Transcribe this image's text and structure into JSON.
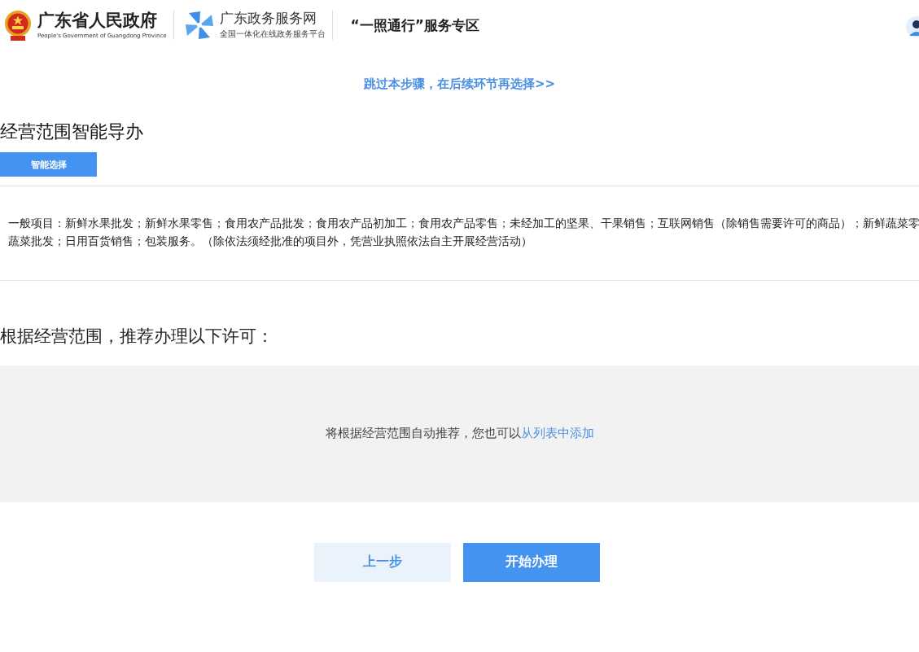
{
  "header": {
    "gov_title": "广东省人民政府",
    "gov_subtitle": "People's Government of Guangdong Province",
    "service_title": "广东政务服务网",
    "service_subtitle": "全国一体化在线政务服务平台",
    "zone_title": "“一照通行”服务专区"
  },
  "skip_link": "跳过本步骤，在后续环节再选择>>",
  "guide": {
    "title": "经营范围智能导办",
    "button": "智能选择"
  },
  "scope_lines": [
    "一般项目：新鲜水果批发；新鲜水果零售；食用农产品批发；食用农产品初加工；食用农产品零售；未经加工的坚果、干果销售；互联网销售（除销售需要许可的商品）；新鲜蔬菜零",
    "蔬菜批发；日用百货销售；包装服务。（除依法须经批准的项目外，凭营业执照依法自主开展经营活动）"
  ],
  "recommend": {
    "title": "根据经营范围，推荐办理以下许可：",
    "hint": "将根据经营范围自动推荐，您也可以",
    "link": "从列表中添加"
  },
  "buttons": [
    {
      "label": "上一步",
      "kind": "secondary"
    },
    {
      "label": "开始办理",
      "kind": "primary"
    }
  ]
}
